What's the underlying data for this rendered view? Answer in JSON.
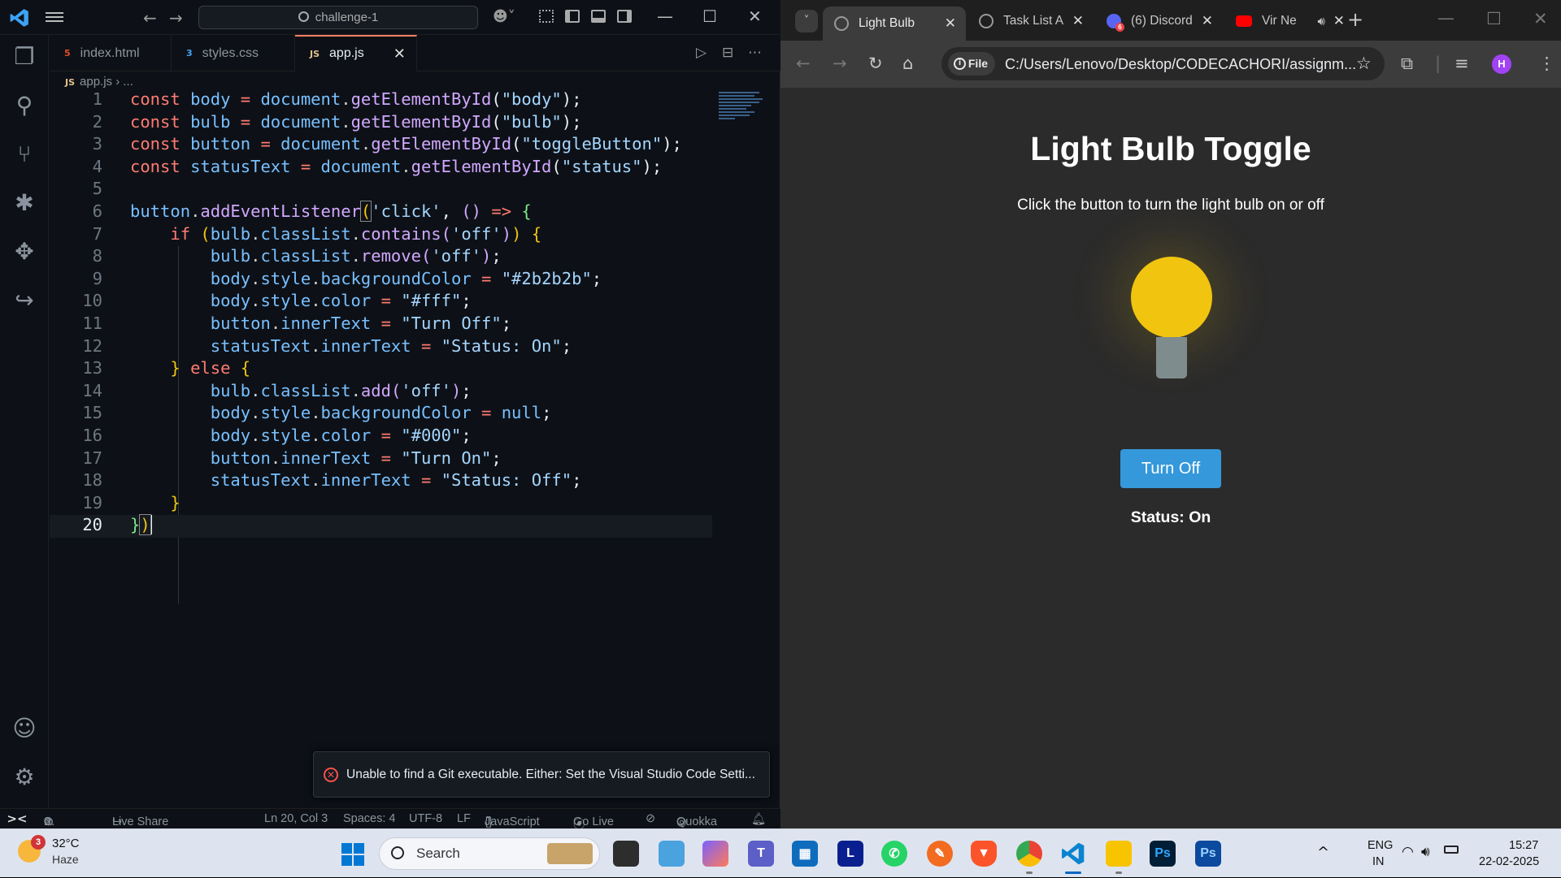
{
  "vscode": {
    "search_text": "challenge-1",
    "tabs": [
      {
        "label": "index.html",
        "icon": "html-icon"
      },
      {
        "label": "styles.css",
        "icon": "css-icon"
      },
      {
        "label": "app.js",
        "icon": "js-icon",
        "active": true
      }
    ],
    "breadcrumb": {
      "file": "app.js",
      "rest": "..."
    },
    "line_numbers": [
      "1",
      "2",
      "3",
      "4",
      "5",
      "6",
      "7",
      "8",
      "9",
      "10",
      "11",
      "12",
      "13",
      "14",
      "15",
      "16",
      "17",
      "18",
      "19",
      "20"
    ],
    "notification": "Unable to find a Git executable. Either: Set the Visual Studio Code Setti...",
    "status": {
      "errors": "0",
      "warnings": "0",
      "live_share": "Live Share",
      "position": "Ln 20, Col 3",
      "spaces": "Spaces: 4",
      "encoding": "UTF-8",
      "eol": "LF",
      "language": "JavaScript",
      "go_live": "Go Live",
      "quokka": "Quokka"
    }
  },
  "chrome": {
    "tabs": [
      {
        "label": "Light Bulb",
        "active": true
      },
      {
        "label": "Task List A"
      },
      {
        "label": "(6) Discord"
      },
      {
        "label": "Vir Ne"
      }
    ],
    "discord_badge": "6",
    "url_chip": "File",
    "url": "C:/Users/Lenovo/Desktop/CODECACHORI/assignm...",
    "profile_initial": "H",
    "page": {
      "title": "Light Bulb Toggle",
      "subtitle": "Click the button to turn the light bulb on or off",
      "button_label": "Turn Off",
      "status": "Status: On"
    }
  },
  "taskbar": {
    "temperature": "32°C",
    "condition": "Haze",
    "weather_badge": "3",
    "search_label": "Search",
    "language": "ENG",
    "region": "IN",
    "time": "15:27",
    "date": "22-02-2025"
  },
  "colors": {
    "vscode_bg": "#0d1117",
    "page_bg": "#2b2b2b",
    "bulb_on": "#f1c40f",
    "bulb_base": "#7f8c8d",
    "button_bg": "#3498db",
    "taskbar_bg": "#dee4ef"
  }
}
